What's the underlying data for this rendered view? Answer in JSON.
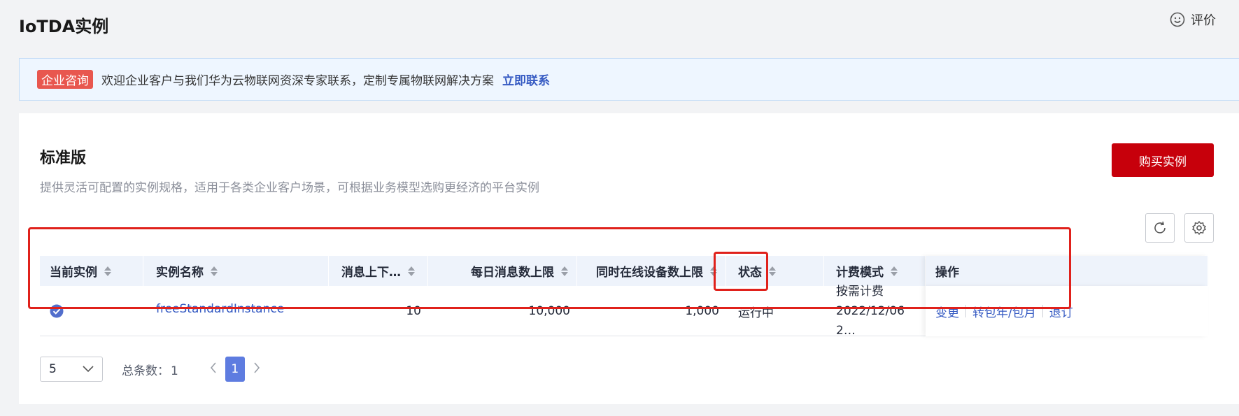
{
  "page": {
    "title": "IoTDA实例",
    "feedback_label": "评价"
  },
  "banner": {
    "tag": "企业咨询",
    "text": "欢迎企业客户与我们华为云物联网资深专家联系，定制专属物联网解决方案",
    "link": "立即联系"
  },
  "section": {
    "title": "标准版",
    "description": "提供灵活可配置的实例规格，适用于各类企业客户场景，可根据业务模型选购更经济的平台实例",
    "buy_button": "购买实例"
  },
  "table": {
    "columns": [
      "当前实例",
      "实例名称",
      "消息上下…",
      "每日消息数上限",
      "同时在线设备数上限",
      "状态",
      "计费模式",
      "操作"
    ],
    "rows": [
      {
        "current": true,
        "name": "freeStandardInstance",
        "msg_tps": "10",
        "daily_limit": "10,000",
        "online_limit": "1,000",
        "status": "运行中",
        "billing_mode": "按需计费",
        "billing_time": "2022/12/06 2…",
        "actions": [
          "变更",
          "转包年/包月",
          "退订"
        ]
      }
    ]
  },
  "pagination": {
    "page_size": "5",
    "total_label": "总条数：",
    "total": "1",
    "current_page": "1"
  },
  "colors": {
    "accent": "#c7000b",
    "link": "#3459c2",
    "highlight": "#e0211b",
    "page_active": "#5e7ce0"
  }
}
